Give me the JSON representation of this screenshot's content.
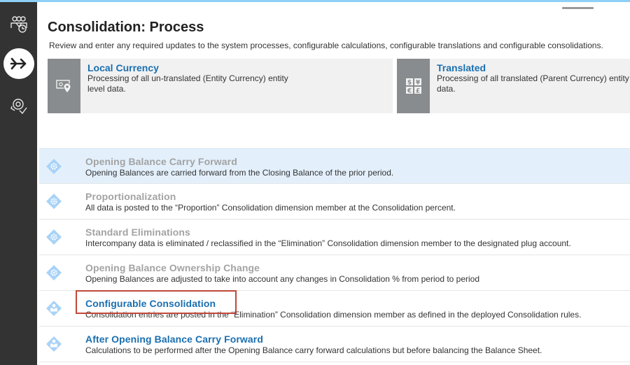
{
  "sidebar": {
    "items": [
      {
        "icon": "people-group-icon",
        "label": "Users"
      },
      {
        "icon": "arrow-merge-icon",
        "label": "Consolidation",
        "active": true
      },
      {
        "icon": "gear-hand-icon",
        "label": "Settings"
      }
    ]
  },
  "header": {
    "title": "Consolidation: Process",
    "description": "Review and enter any required updates to the system processes, configurable calculations, configurable translations and configurable consolidations."
  },
  "cards": [
    {
      "icon": "currency-location-icon",
      "title": "Local Currency",
      "text": "Processing of all un-translated (Entity Currency) entity level data."
    },
    {
      "icon": "currency-symbols-icon",
      "title": "Translated",
      "text": "Processing of all translated (Parent Currency) entity level data."
    }
  ],
  "processes": [
    {
      "title": "Opening Balance Carry Forward",
      "description": "Opening Balances are carried forward from the Closing Balance of the prior period.",
      "icon": "system-gear-icon",
      "configurable": false,
      "selected": true
    },
    {
      "title": "Proportionalization",
      "description": "All data is posted to the “Proportion” Consolidation dimension member at the Consolidation percent.",
      "icon": "system-gear-icon",
      "configurable": false,
      "selected": false
    },
    {
      "title": "Standard Eliminations",
      "description": "Intercompany data is eliminated / reclassified in the “Elimination” Consolidation dimension member to the designated plug account.",
      "icon": "system-gear-icon",
      "configurable": false,
      "selected": false
    },
    {
      "title": "Opening Balance Ownership Change",
      "description": "Opening Balances are adjusted to take into account any changes in Consolidation % from period to period",
      "icon": "system-gear-icon",
      "configurable": false,
      "selected": false
    },
    {
      "title": "Configurable Consolidation",
      "description": "Consolidation entries are posted in the “Elimination” Consolidation dimension member as defined in the deployed Consolidation rules.",
      "icon": "user-configurable-icon",
      "configurable": true,
      "selected": false
    },
    {
      "title": "After Opening Balance Carry Forward",
      "description": "Calculations to be performed after the Opening Balance carry forward calculations but before balancing the Balance Sheet.",
      "icon": "user-configurable-icon",
      "configurable": true,
      "selected": false
    }
  ],
  "colors": {
    "accent": "#1a6fb0",
    "inactive_title": "#a3a3a3",
    "sidebar": "#333333",
    "selected_row": "#e3f0fc",
    "highlight": "#c0493a",
    "topbar": "#8fd0f8"
  }
}
